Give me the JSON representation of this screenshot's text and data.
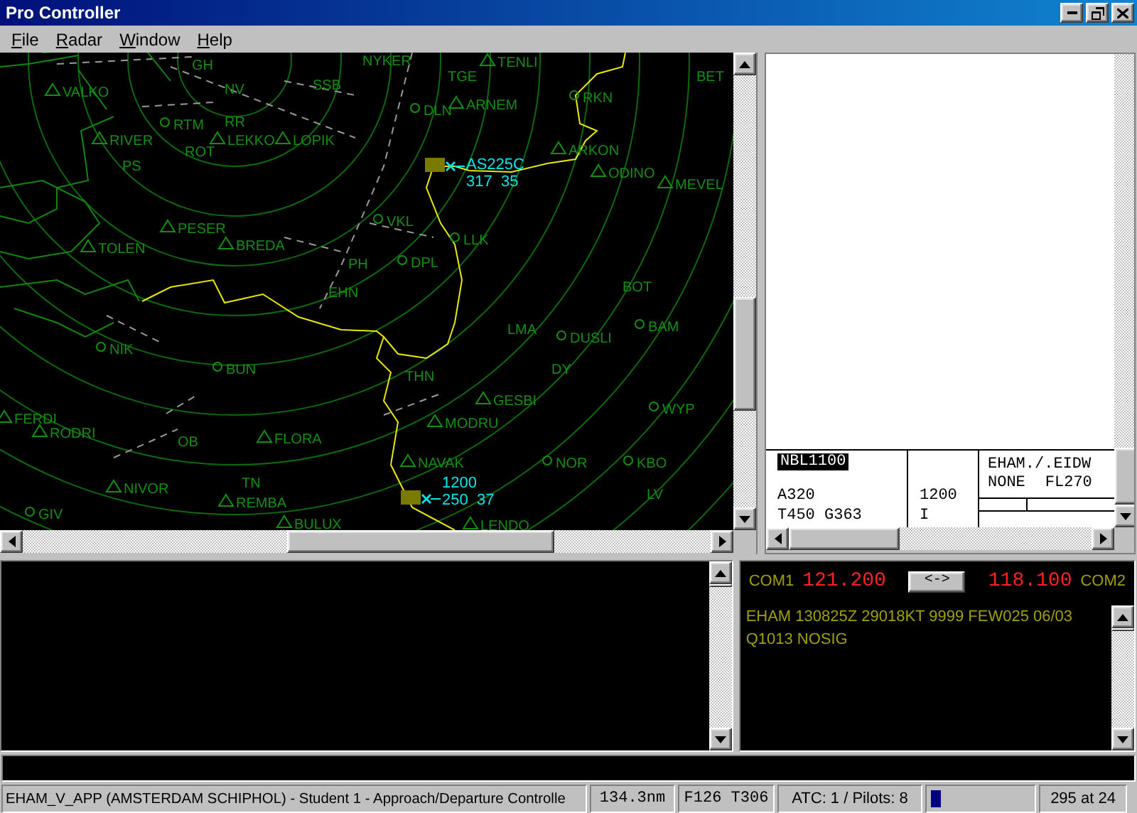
{
  "window": {
    "title": "Pro Controller"
  },
  "menu": [
    {
      "label": "File"
    },
    {
      "label": "Radar"
    },
    {
      "label": "Window"
    },
    {
      "label": "Help"
    }
  ],
  "radar": {
    "fixes": [
      {
        "name": "VALKO",
        "kind": "triangle"
      },
      {
        "name": "RIVER",
        "kind": "triangle"
      },
      {
        "name": "LEKKO",
        "kind": "triangle"
      },
      {
        "name": "LOPIK",
        "kind": "triangle"
      },
      {
        "name": "PESER",
        "kind": "triangle"
      },
      {
        "name": "TOLEN",
        "kind": "triangle"
      },
      {
        "name": "BREDA",
        "kind": "triangle"
      },
      {
        "name": "NYKER",
        "kind": "plain"
      },
      {
        "name": "TENLI",
        "kind": "triangle"
      },
      {
        "name": "ARNEM",
        "kind": "triangle"
      },
      {
        "name": "ARKON",
        "kind": "triangle"
      },
      {
        "name": "ODINO",
        "kind": "triangle"
      },
      {
        "name": "MEVEL",
        "kind": "triangle"
      },
      {
        "name": "FERDI",
        "kind": "triangle"
      },
      {
        "name": "RODRI",
        "kind": "triangle"
      },
      {
        "name": "FLORA",
        "kind": "triangle"
      },
      {
        "name": "NIVOR",
        "kind": "triangle"
      },
      {
        "name": "REMBA",
        "kind": "triangle"
      },
      {
        "name": "BULUX",
        "kind": "triangle"
      },
      {
        "name": "GESBI",
        "kind": "triangle"
      },
      {
        "name": "MODRU",
        "kind": "triangle"
      },
      {
        "name": "NAVAK",
        "kind": "triangle"
      },
      {
        "name": "LENDO",
        "kind": "triangle"
      },
      {
        "name": "RTM",
        "kind": "circle"
      },
      {
        "name": "DLN",
        "kind": "circle"
      },
      {
        "name": "RKN",
        "kind": "circle"
      },
      {
        "name": "VKL",
        "kind": "circle"
      },
      {
        "name": "DPL",
        "kind": "circle"
      },
      {
        "name": "LLK",
        "kind": "circle"
      },
      {
        "name": "NIK",
        "kind": "circle"
      },
      {
        "name": "BUN",
        "kind": "circle"
      },
      {
        "name": "GIV",
        "kind": "circle"
      },
      {
        "name": "NOR",
        "kind": "circle"
      },
      {
        "name": "DUSLI",
        "kind": "circle"
      },
      {
        "name": "BAM",
        "kind": "circle"
      },
      {
        "name": "WYP",
        "kind": "circle"
      },
      {
        "name": "KBO",
        "kind": "circle"
      },
      {
        "name": "PS",
        "kind": "plain"
      },
      {
        "name": "RR",
        "kind": "plain"
      },
      {
        "name": "ROT",
        "kind": "plain"
      },
      {
        "name": "PH",
        "kind": "plain"
      },
      {
        "name": "EHN",
        "kind": "plain"
      },
      {
        "name": "TGE",
        "kind": "plain"
      },
      {
        "name": "BET",
        "kind": "plain"
      },
      {
        "name": "BOT",
        "kind": "plain"
      },
      {
        "name": "LMA",
        "kind": "plain"
      },
      {
        "name": "DY",
        "kind": "plain"
      },
      {
        "name": "OB",
        "kind": "plain"
      },
      {
        "name": "TN",
        "kind": "plain"
      },
      {
        "name": "THN",
        "kind": "plain"
      },
      {
        "name": "LV",
        "kind": "plain"
      },
      {
        "name": "GH",
        "kind": "plain"
      },
      {
        "name": "NV",
        "kind": "plain"
      },
      {
        "name": "SSB",
        "kind": "plain"
      }
    ],
    "aircraft": [
      {
        "lines": [
          "AS225C",
          "317  35"
        ]
      },
      {
        "lines": [
          "1200",
          "250  37"
        ]
      }
    ]
  },
  "flight_strip": {
    "callsign": "NBL1100",
    "selected": true,
    "type": "A320",
    "speeds": "T450 G363",
    "squawk": "1200",
    "rules": "I",
    "route": "EHAM./.EIDW",
    "remarks": "NONE",
    "flight_level": "FL270"
  },
  "comms": {
    "com1_label": "COM1",
    "com1_freq": "121.200",
    "swap_button": "<->",
    "com2_freq": "118.100",
    "com2_label": "COM2"
  },
  "metar": "EHAM 130825Z 29018KT 9999 FEW025 06/03 Q1013 NOSIG",
  "status_bar": {
    "station": "EHAM_V_APP (AMSTERDAM SCHIPHOL) - Student 1 - Approach/Departure Controlle",
    "range": "134.3nm",
    "cursor": "F126 T306",
    "counts": "ATC: 1 / Pilots: 8",
    "level": 0.1,
    "position": "295 at 24"
  }
}
